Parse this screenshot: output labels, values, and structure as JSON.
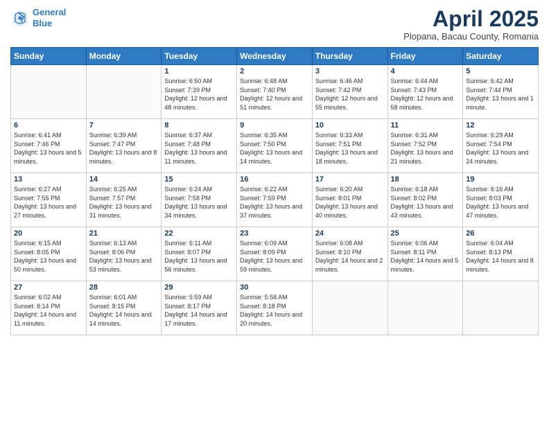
{
  "header": {
    "logo_line1": "General",
    "logo_line2": "Blue",
    "title": "April 2025",
    "subtitle": "Plopana, Bacau County, Romania"
  },
  "days_of_week": [
    "Sunday",
    "Monday",
    "Tuesday",
    "Wednesday",
    "Thursday",
    "Friday",
    "Saturday"
  ],
  "weeks": [
    [
      {
        "num": "",
        "sunrise": "",
        "sunset": "",
        "daylight": ""
      },
      {
        "num": "",
        "sunrise": "",
        "sunset": "",
        "daylight": ""
      },
      {
        "num": "1",
        "sunrise": "Sunrise: 6:50 AM",
        "sunset": "Sunset: 7:39 PM",
        "daylight": "Daylight: 12 hours and 48 minutes."
      },
      {
        "num": "2",
        "sunrise": "Sunrise: 6:48 AM",
        "sunset": "Sunset: 7:40 PM",
        "daylight": "Daylight: 12 hours and 51 minutes."
      },
      {
        "num": "3",
        "sunrise": "Sunrise: 6:46 AM",
        "sunset": "Sunset: 7:42 PM",
        "daylight": "Daylight: 12 hours and 55 minutes."
      },
      {
        "num": "4",
        "sunrise": "Sunrise: 6:44 AM",
        "sunset": "Sunset: 7:43 PM",
        "daylight": "Daylight: 12 hours and 58 minutes."
      },
      {
        "num": "5",
        "sunrise": "Sunrise: 6:42 AM",
        "sunset": "Sunset: 7:44 PM",
        "daylight": "Daylight: 13 hours and 1 minute."
      }
    ],
    [
      {
        "num": "6",
        "sunrise": "Sunrise: 6:41 AM",
        "sunset": "Sunset: 7:46 PM",
        "daylight": "Daylight: 13 hours and 5 minutes."
      },
      {
        "num": "7",
        "sunrise": "Sunrise: 6:39 AM",
        "sunset": "Sunset: 7:47 PM",
        "daylight": "Daylight: 13 hours and 8 minutes."
      },
      {
        "num": "8",
        "sunrise": "Sunrise: 6:37 AM",
        "sunset": "Sunset: 7:48 PM",
        "daylight": "Daylight: 13 hours and 11 minutes."
      },
      {
        "num": "9",
        "sunrise": "Sunrise: 6:35 AM",
        "sunset": "Sunset: 7:50 PM",
        "daylight": "Daylight: 13 hours and 14 minutes."
      },
      {
        "num": "10",
        "sunrise": "Sunrise: 6:33 AM",
        "sunset": "Sunset: 7:51 PM",
        "daylight": "Daylight: 13 hours and 18 minutes."
      },
      {
        "num": "11",
        "sunrise": "Sunrise: 6:31 AM",
        "sunset": "Sunset: 7:52 PM",
        "daylight": "Daylight: 13 hours and 21 minutes."
      },
      {
        "num": "12",
        "sunrise": "Sunrise: 6:29 AM",
        "sunset": "Sunset: 7:54 PM",
        "daylight": "Daylight: 13 hours and 24 minutes."
      }
    ],
    [
      {
        "num": "13",
        "sunrise": "Sunrise: 6:27 AM",
        "sunset": "Sunset: 7:55 PM",
        "daylight": "Daylight: 13 hours and 27 minutes."
      },
      {
        "num": "14",
        "sunrise": "Sunrise: 6:25 AM",
        "sunset": "Sunset: 7:57 PM",
        "daylight": "Daylight: 13 hours and 31 minutes."
      },
      {
        "num": "15",
        "sunrise": "Sunrise: 6:24 AM",
        "sunset": "Sunset: 7:58 PM",
        "daylight": "Daylight: 13 hours and 34 minutes."
      },
      {
        "num": "16",
        "sunrise": "Sunrise: 6:22 AM",
        "sunset": "Sunset: 7:59 PM",
        "daylight": "Daylight: 13 hours and 37 minutes."
      },
      {
        "num": "17",
        "sunrise": "Sunrise: 6:20 AM",
        "sunset": "Sunset: 8:01 PM",
        "daylight": "Daylight: 13 hours and 40 minutes."
      },
      {
        "num": "18",
        "sunrise": "Sunrise: 6:18 AM",
        "sunset": "Sunset: 8:02 PM",
        "daylight": "Daylight: 13 hours and 43 minutes."
      },
      {
        "num": "19",
        "sunrise": "Sunrise: 6:16 AM",
        "sunset": "Sunset: 8:03 PM",
        "daylight": "Daylight: 13 hours and 47 minutes."
      }
    ],
    [
      {
        "num": "20",
        "sunrise": "Sunrise: 6:15 AM",
        "sunset": "Sunset: 8:05 PM",
        "daylight": "Daylight: 13 hours and 50 minutes."
      },
      {
        "num": "21",
        "sunrise": "Sunrise: 6:13 AM",
        "sunset": "Sunset: 8:06 PM",
        "daylight": "Daylight: 13 hours and 53 minutes."
      },
      {
        "num": "22",
        "sunrise": "Sunrise: 6:11 AM",
        "sunset": "Sunset: 8:07 PM",
        "daylight": "Daylight: 13 hours and 56 minutes."
      },
      {
        "num": "23",
        "sunrise": "Sunrise: 6:09 AM",
        "sunset": "Sunset: 8:09 PM",
        "daylight": "Daylight: 13 hours and 59 minutes."
      },
      {
        "num": "24",
        "sunrise": "Sunrise: 6:08 AM",
        "sunset": "Sunset: 8:10 PM",
        "daylight": "Daylight: 14 hours and 2 minutes."
      },
      {
        "num": "25",
        "sunrise": "Sunrise: 6:06 AM",
        "sunset": "Sunset: 8:11 PM",
        "daylight": "Daylight: 14 hours and 5 minutes."
      },
      {
        "num": "26",
        "sunrise": "Sunrise: 6:04 AM",
        "sunset": "Sunset: 8:13 PM",
        "daylight": "Daylight: 14 hours and 8 minutes."
      }
    ],
    [
      {
        "num": "27",
        "sunrise": "Sunrise: 6:02 AM",
        "sunset": "Sunset: 8:14 PM",
        "daylight": "Daylight: 14 hours and 11 minutes."
      },
      {
        "num": "28",
        "sunrise": "Sunrise: 6:01 AM",
        "sunset": "Sunset: 8:15 PM",
        "daylight": "Daylight: 14 hours and 14 minutes."
      },
      {
        "num": "29",
        "sunrise": "Sunrise: 5:59 AM",
        "sunset": "Sunset: 8:17 PM",
        "daylight": "Daylight: 14 hours and 17 minutes."
      },
      {
        "num": "30",
        "sunrise": "Sunrise: 5:58 AM",
        "sunset": "Sunset: 8:18 PM",
        "daylight": "Daylight: 14 hours and 20 minutes."
      },
      {
        "num": "",
        "sunrise": "",
        "sunset": "",
        "daylight": ""
      },
      {
        "num": "",
        "sunrise": "",
        "sunset": "",
        "daylight": ""
      },
      {
        "num": "",
        "sunrise": "",
        "sunset": "",
        "daylight": ""
      }
    ]
  ]
}
